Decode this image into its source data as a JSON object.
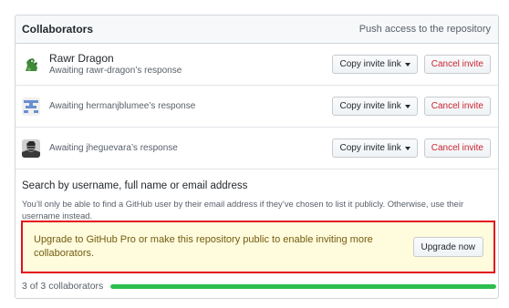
{
  "header": {
    "title": "Collaborators",
    "right_text": "Push access to the repository"
  },
  "collaborators": [
    {
      "name": "Rawr Dragon",
      "status": "Awaiting rawr-dragon’s response",
      "avatar": "dragon-avatar",
      "copy_label": "Copy invite link",
      "cancel_label": "Cancel invite"
    },
    {
      "name": "",
      "status": "Awaiting hermanjblumee’s response",
      "avatar": "identicon-avatar",
      "copy_label": "Copy invite link",
      "cancel_label": "Cancel invite"
    },
    {
      "name": "",
      "status": "Awaiting jheguevara’s response",
      "avatar": "photo-avatar",
      "copy_label": "Copy invite link",
      "cancel_label": "Cancel invite"
    }
  ],
  "search": {
    "title": "Search by username, full name or email address",
    "note": "You’ll only be able to find a GitHub user by their email address if they’ve chosen to list it publicly. Otherwise, use their username instead."
  },
  "upgrade": {
    "message": "Upgrade to GitHub Pro or make this repository public to enable inviting more collaborators.",
    "button_label": "Upgrade now"
  },
  "footer": {
    "count_text": "3 of 3 collaborators",
    "progress": 1.0
  },
  "colors": {
    "progress": "#2cbe4e",
    "cancel": "#cb2431",
    "highlight_border": "#e3101e",
    "upgrade_bg": "#fffbdd"
  }
}
